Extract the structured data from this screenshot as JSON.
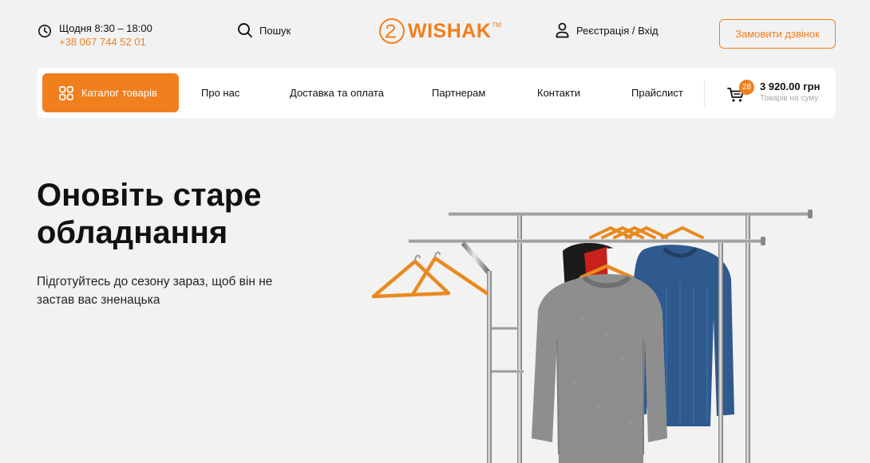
{
  "header": {
    "hours_text": "Щодня 8:30 – 18:00",
    "phone": "+38 067 744 52 01",
    "search_label": "Пошук",
    "logo_text": "WISHAK",
    "logo_tm": "TM",
    "auth_label": "Реєстрація / Вхід",
    "callback_label": "Замовити дзвінок"
  },
  "nav": {
    "catalog_label": "Каталог товарів",
    "items": [
      "Про нас",
      "Доставка та оплата",
      "Партнерам",
      "Контакти",
      "Прайслист"
    ]
  },
  "cart": {
    "count": "28",
    "total": "3 920.00 грн",
    "total_label": "Товарів на суму"
  },
  "hero": {
    "title_line1": "Оновіть старе",
    "title_line2": "обладнання",
    "subtitle_line1": "Підготуйтесь до сезону зараз, щоб він не",
    "subtitle_line2": "застав вас зненацька"
  },
  "icons": {
    "hours": "clock-icon",
    "search": "search-icon",
    "user": "user-icon",
    "catalog": "grid-icon",
    "cart": "cart-icon"
  },
  "colors": {
    "accent": "#f07f1e",
    "background": "#f2f2f2",
    "surface": "#ffffff",
    "text": "#111111",
    "muted": "#a8a8a8"
  }
}
